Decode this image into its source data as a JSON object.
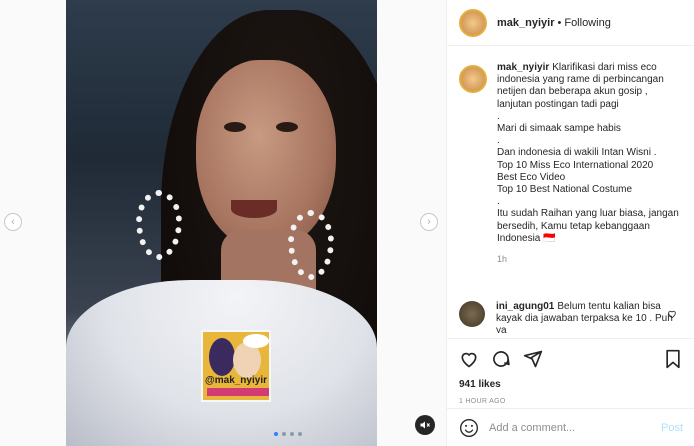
{
  "post": {
    "username": "mak_nyiyir",
    "separator": "•",
    "follow_status": "Following"
  },
  "caption": {
    "username": "mak_nyiyir",
    "lines": [
      "Klarifikasi dari miss eco indonesia yang rame di perbincangan netijen dan beberapa akun gosip , lanjutan postingan tadi pagi",
      ".",
      "Mari di simaak sampe habis",
      ".",
      "Dan indonesia di wakili Intan Wisni .",
      "Top 10 Miss Eco International 2020",
      "Best Eco Video",
      "Top 10 Best National Costume",
      ".",
      "Itu sudah Raihan yang luar biasa, jangan bersedih, Kamu tetap kebanggaan Indonesia 🇮🇩"
    ],
    "time": "1h"
  },
  "comment": {
    "username": "ini_agung01",
    "text": "Belum tentu kalian bisa kayak dia jawaban terpaksa ke 10 . Puh ya"
  },
  "actions": {
    "likes": "941 likes",
    "posted_ago": "1 HOUR AGO"
  },
  "add_comment": {
    "placeholder": "Add a comment...",
    "post_label": "Post"
  },
  "media": {
    "sticker_handle": "@mak_nyiyir",
    "carousel_dots": 4,
    "active_dot": 1
  },
  "icons": {
    "prev": "chevron-left-icon",
    "next": "chevron-right-icon",
    "mute": "sound-off-icon",
    "like": "heart-icon",
    "comment": "comment-icon",
    "share": "share-icon",
    "save": "bookmark-icon",
    "emoji": "smile-icon"
  },
  "colors": {
    "accent_blue": "#0095f6",
    "post_disabled": "#b2dffc",
    "muted_text": "#8e8e8e"
  }
}
